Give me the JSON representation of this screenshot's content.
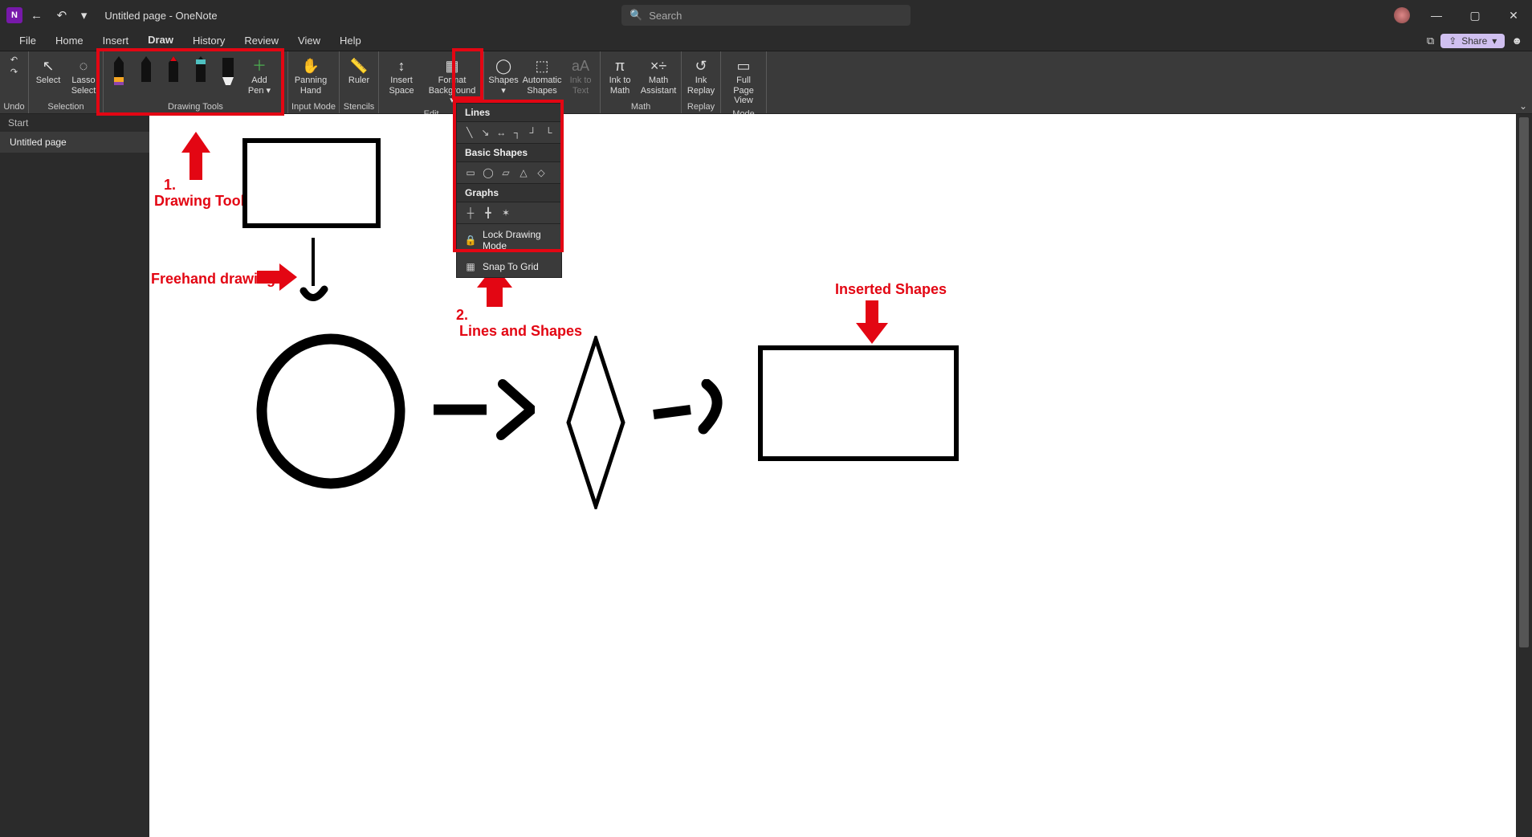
{
  "titlebar": {
    "app_letter": "N",
    "title": "Untitled page  -  OneNote",
    "search_placeholder": "Search"
  },
  "window_controls": {
    "minimize": "—",
    "maximize": "▢",
    "close": "✕"
  },
  "menubar": {
    "items": [
      "File",
      "Home",
      "Insert",
      "Draw",
      "History",
      "Review",
      "View",
      "Help"
    ],
    "active_index": 3,
    "share_label": "Share"
  },
  "ribbon": {
    "undo_group": {
      "undo": "↶",
      "redo": "↷",
      "label": "Undo"
    },
    "selection_group": {
      "select": "Select",
      "lasso": "Lasso Select",
      "label": "Selection"
    },
    "drawing_tools_group": {
      "add_pen": "Add Pen ▾",
      "label": "Drawing Tools"
    },
    "input_mode_group": {
      "panning_hand": "Panning Hand",
      "label": "Input Mode"
    },
    "stencils_group": {
      "ruler": "Ruler",
      "label": "Stencils"
    },
    "edit_group": {
      "insert_space": "Insert Space",
      "format_background": "Format Background ▾",
      "label": "Edit"
    },
    "shapes_group": {
      "shapes": "Shapes ▾",
      "auto_shapes": "Automatic Shapes",
      "ink_to_text": "Ink to Text"
    },
    "math_group": {
      "ink_to_math": "Ink to Math",
      "math_assistant": "Math Assistant",
      "label": "Math"
    },
    "replay_group": {
      "ink_replay": "Ink Replay",
      "label": "Replay"
    },
    "mode_group": {
      "full_page": "Full Page View",
      "label": "Mode"
    }
  },
  "shapes_dropdown": {
    "lines_header": "Lines",
    "basic_header": "Basic Shapes",
    "graphs_header": "Graphs",
    "lock": "Lock Drawing Mode",
    "snap": "Snap To Grid"
  },
  "sidebar": {
    "section": "Start",
    "page": "Untitled page"
  },
  "annotations": {
    "a1_num": "1.",
    "a1_label": "Drawing Tools",
    "a2_label": "Freehand drawing",
    "a3_num": "2.",
    "a3_label": "Lines and Shapes",
    "a4_label": "Inserted Shapes"
  }
}
